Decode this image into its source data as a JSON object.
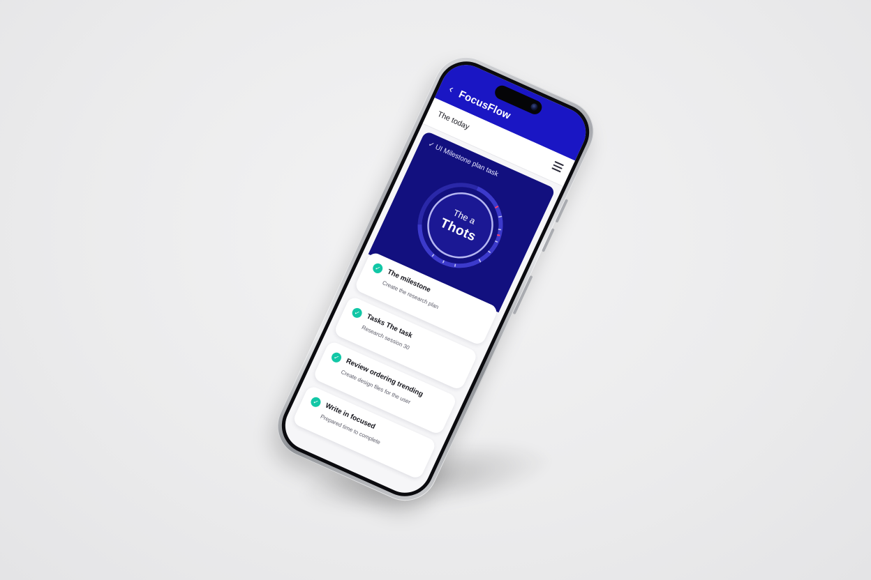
{
  "app": {
    "title": "FocusFlow",
    "back_icon": "chevron-left-icon"
  },
  "subheader": {
    "title": "The today",
    "menu_icon": "hamburger-menu-icon"
  },
  "hero": {
    "label": "✓ UI Milestone plan task",
    "ring_line1": "The a",
    "ring_line2": "Thots",
    "colors": {
      "background": "#12107f",
      "ring": "#8b8ce8",
      "accent": "#ff3b6b"
    }
  },
  "tasks": [
    {
      "title": "The milestone",
      "subtitle": "Create the research plan",
      "status_icon": "check-circle-icon"
    },
    {
      "title": "Tasks The task",
      "subtitle": "Research session 30",
      "status_icon": "check-circle-icon"
    },
    {
      "title": "Review ordering trending",
      "subtitle": "Create design files for the user",
      "status_icon": "check-circle-icon"
    },
    {
      "title": "Write in focused",
      "subtitle": "Prepared time to complete",
      "status_icon": "check-circle-icon"
    }
  ],
  "colors": {
    "app_bar": "#1a16c4",
    "check": "#12c7a6"
  }
}
